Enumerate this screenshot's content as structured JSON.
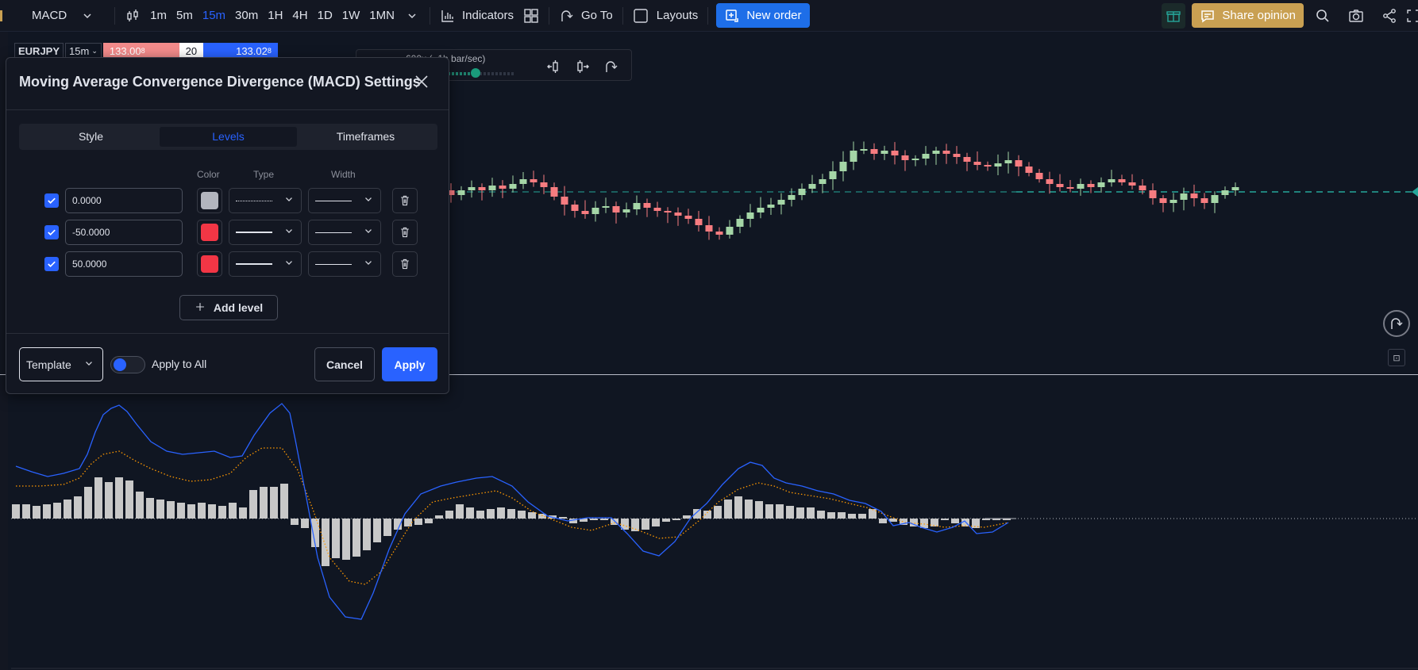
{
  "toolbar": {
    "indicator_name": "MACD",
    "timeframes": [
      "1m",
      "5m",
      "15m",
      "30m",
      "1H",
      "4H",
      "1D",
      "1W",
      "1MN"
    ],
    "active_timeframe": "15m",
    "indicators_label": "Indicators",
    "goto_label": "Go To",
    "layouts_label": "Layouts",
    "new_order_label": "New order",
    "share_label": "Share opinion"
  },
  "symbol": {
    "name": "EURJPY",
    "timeframe": "15m",
    "bid": "133.00",
    "bid_sup": "8",
    "spread": "20",
    "ask": "133.02",
    "ask_sup": "8"
  },
  "replay": {
    "speed_label": "600x (~1h bar/sec)",
    "progress": 0.45
  },
  "dialog": {
    "title": "Moving Average Convergence Divergence (MACD) Settings",
    "tabs": [
      {
        "label": "Style"
      },
      {
        "label": "Levels"
      },
      {
        "label": "Timeframes"
      }
    ],
    "active_tab": "Levels",
    "columns": {
      "color": "Color",
      "type": "Type",
      "width": "Width"
    },
    "levels": [
      {
        "checked": true,
        "value": "0.0000",
        "color": "#b2b5be",
        "type": "dotted",
        "width": "thin"
      },
      {
        "checked": true,
        "value": "-50.0000",
        "color": "#f23645",
        "type": "solid",
        "width": "thin"
      },
      {
        "checked": true,
        "value": "50.0000",
        "color": "#f23645",
        "type": "solid",
        "width": "thin"
      }
    ],
    "add_level_label": "Add level",
    "template_label": "Template",
    "apply_to_all_label": "Apply to All",
    "apply_to_all_on": false,
    "cancel_label": "Cancel",
    "apply_label": "Apply"
  },
  "colors": {
    "background": "#101622",
    "up_candle": "#a5d6a7",
    "down_candle": "#f77c80",
    "accent": "#2962ff",
    "macd_line": "#2962ff",
    "signal_line": "#ff9800",
    "histogram": "#c8c8c8"
  }
}
